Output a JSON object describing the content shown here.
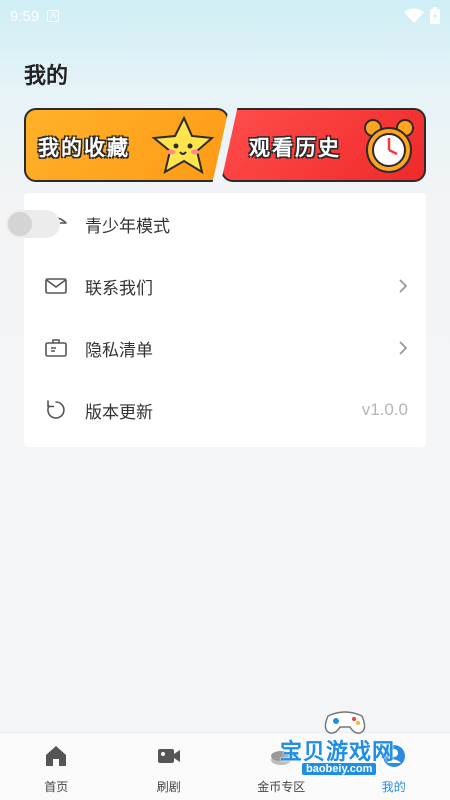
{
  "status_bar": {
    "time": "9:59",
    "a_badge": "A"
  },
  "page_title": "我的",
  "cards": {
    "favorites": "我的收藏",
    "history": "观看历史"
  },
  "menu": {
    "items": [
      {
        "label": "青少年模式",
        "icon": "umbrella-icon",
        "right": "toggle",
        "toggle_on": false
      },
      {
        "label": "联系我们",
        "icon": "mail-icon",
        "right": "chevron"
      },
      {
        "label": "隐私清单",
        "icon": "briefcase-icon",
        "right": "chevron"
      },
      {
        "label": "版本更新",
        "icon": "refresh-icon",
        "right": "text",
        "value": "v1.0.0"
      }
    ]
  },
  "tabbar": {
    "tabs": [
      {
        "label": "首页",
        "icon": "home-icon"
      },
      {
        "label": "刷剧",
        "icon": "video-icon"
      },
      {
        "label": "金币专区",
        "icon": "coin-icon"
      },
      {
        "label": "我的",
        "icon": "profile-icon",
        "active": true
      }
    ]
  },
  "watermark": {
    "text": "宝贝游戏网",
    "url": "baobeiy.com"
  },
  "colors": {
    "accent": "#2b8be0",
    "fav_card": "#ffa51f",
    "history_card": "#f23a3a"
  }
}
